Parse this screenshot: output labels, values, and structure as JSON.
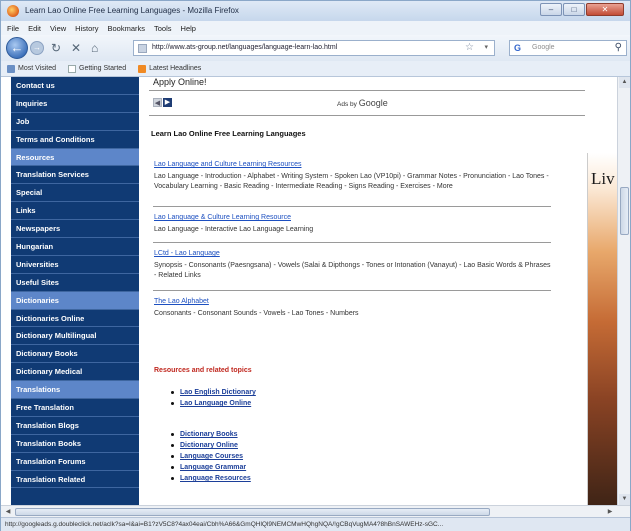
{
  "window": {
    "title": "Learn Lao Online Free Learning Languages - Mozilla Firefox",
    "controls": [
      "–",
      "□",
      "✕"
    ]
  },
  "menu": [
    "File",
    "Edit",
    "View",
    "History",
    "Bookmarks",
    "Tools",
    "Help"
  ],
  "nav": {
    "url": "http://www.ats-group.net/languages/language-learn-lao.html",
    "search_engine": "G",
    "search_placeholder": "Google"
  },
  "bookmarks": [
    {
      "label": "Most Visited",
      "icon": "star-icon"
    },
    {
      "label": "Getting Started",
      "icon": "page-icon"
    },
    {
      "label": "Latest Headlines",
      "icon": "rss-icon"
    }
  ],
  "sidebar": [
    {
      "label": "Contact us",
      "highlight": false
    },
    {
      "label": "Inquiries",
      "highlight": false
    },
    {
      "label": "Job",
      "highlight": false
    },
    {
      "label": "Terms and Conditions",
      "highlight": false
    },
    {
      "label": "Resources",
      "highlight": true
    },
    {
      "label": "Translation Services",
      "highlight": false
    },
    {
      "label": "Special",
      "highlight": false
    },
    {
      "label": "Links",
      "highlight": false
    },
    {
      "label": "Newspapers",
      "highlight": false
    },
    {
      "label": "Hungarian",
      "highlight": false
    },
    {
      "label": "Universities",
      "highlight": false
    },
    {
      "label": "Useful Sites",
      "highlight": false
    },
    {
      "label": "Dictionaries",
      "highlight": true
    },
    {
      "label": "Dictionaries Online",
      "highlight": false
    },
    {
      "label": "Dictionary Multilingual",
      "highlight": false
    },
    {
      "label": "Dictionary Books",
      "highlight": false
    },
    {
      "label": "Dictionary Medical",
      "highlight": false
    },
    {
      "label": "Translations",
      "highlight": true
    },
    {
      "label": "Free Translation",
      "highlight": false
    },
    {
      "label": "Translation Blogs",
      "highlight": false
    },
    {
      "label": "Translation Books",
      "highlight": false
    },
    {
      "label": "Translation Forums",
      "highlight": false
    },
    {
      "label": "Translation Related",
      "highlight": false
    }
  ],
  "main": {
    "apply_text": "Apply Online!",
    "ads_by": "Ads by",
    "ads_brand": "Google",
    "page_title": "Learn Lao Online Free Learning Languages",
    "sections": [
      {
        "link": "Lao Language and Culture Learning Resources",
        "desc": "Lao Language - Introduction - Alphabet - Writing System - Spoken Lao (VP10pi) - Grammar Notes - Pronunciation - Lao Tones - Vocabulary Learning - Basic Reading - Intermediate Reading - Signs Reading - Exercises - More"
      },
      {
        "link": "Lao Language & Culture Learning Resource",
        "desc": "Lao Language - Interactive Lao Language Learning"
      },
      {
        "link": "LCtd - Lao Language",
        "desc": "Synopsis - Consonants (Paesngsana) - Vowels (Salai & Dipthongs - Tones or Intonation (Vanayut) - Lao Basic Words & Phrases - Related Links"
      },
      {
        "link": "The Lao Alphabet",
        "desc": "Consonants - Consonant Sounds - Vowels - Lao Tones - Numbers"
      }
    ],
    "resources_heading": "Resources and related topics",
    "resources_a": [
      "Lao English Dictionary",
      "Lao Language Online"
    ],
    "resources_b": [
      "Dictionary Books",
      "Dictionary Online",
      "Language Courses",
      "Language Grammar",
      "Language Resources"
    ]
  },
  "right_ad_text": "Liv",
  "status": "http://googleads.g.doubleclick.net/aclk?sa=l&ai=B1?zV5C8?4ax04eai/Cbh%A66&GmQHlQl9NEMCMwHQhgNQA/!gCBqVugMA4?8hBnSAWEHz-sGC..."
}
